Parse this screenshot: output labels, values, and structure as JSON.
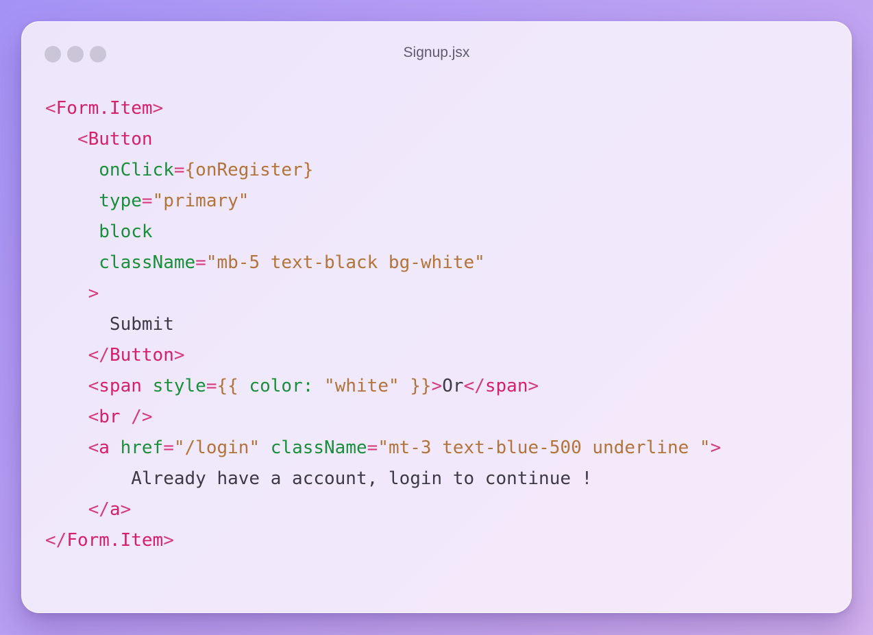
{
  "window": {
    "title": "Signup.jsx",
    "controls": [
      "window-dot",
      "window-dot",
      "window-dot"
    ]
  },
  "code": {
    "lines": [
      [
        {
          "t": "<",
          "c": "pun"
        },
        {
          "t": "Form.Item",
          "c": "tag"
        },
        {
          "t": ">",
          "c": "pun"
        }
      ],
      [
        {
          "t": "   ",
          "c": "txt"
        },
        {
          "t": "<",
          "c": "pun"
        },
        {
          "t": "Button",
          "c": "tag"
        }
      ],
      [
        {
          "t": "     ",
          "c": "txt"
        },
        {
          "t": "onClick",
          "c": "attr"
        },
        {
          "t": "=",
          "c": "pun"
        },
        {
          "t": "{onRegister}",
          "c": "str"
        }
      ],
      [
        {
          "t": "     ",
          "c": "txt"
        },
        {
          "t": "type",
          "c": "attr"
        },
        {
          "t": "=",
          "c": "pun"
        },
        {
          "t": "\"primary\"",
          "c": "str"
        }
      ],
      [
        {
          "t": "     ",
          "c": "txt"
        },
        {
          "t": "block",
          "c": "attr"
        }
      ],
      [
        {
          "t": "     ",
          "c": "txt"
        },
        {
          "t": "className",
          "c": "attr"
        },
        {
          "t": "=",
          "c": "pun"
        },
        {
          "t": "\"mb-5 text-black bg-white\"",
          "c": "str"
        }
      ],
      [
        {
          "t": "    ",
          "c": "txt"
        },
        {
          "t": ">",
          "c": "pun"
        }
      ],
      [
        {
          "t": "      ",
          "c": "txt"
        },
        {
          "t": "Submit",
          "c": "txt"
        }
      ],
      [
        {
          "t": "    ",
          "c": "txt"
        },
        {
          "t": "</",
          "c": "pun"
        },
        {
          "t": "Button",
          "c": "tag"
        },
        {
          "t": ">",
          "c": "pun"
        }
      ],
      [
        {
          "t": "    ",
          "c": "txt"
        },
        {
          "t": "<",
          "c": "pun"
        },
        {
          "t": "span",
          "c": "tag"
        },
        {
          "t": " ",
          "c": "txt"
        },
        {
          "t": "style",
          "c": "attr"
        },
        {
          "t": "=",
          "c": "pun"
        },
        {
          "t": "{{",
          "c": "str"
        },
        {
          "t": " ",
          "c": "txt"
        },
        {
          "t": "color:",
          "c": "attr"
        },
        {
          "t": " ",
          "c": "txt"
        },
        {
          "t": "\"white\"",
          "c": "str"
        },
        {
          "t": " ",
          "c": "txt"
        },
        {
          "t": "}}",
          "c": "str"
        },
        {
          "t": ">",
          "c": "pun"
        },
        {
          "t": "Or",
          "c": "txt"
        },
        {
          "t": "</",
          "c": "pun"
        },
        {
          "t": "span",
          "c": "tag"
        },
        {
          "t": ">",
          "c": "pun"
        }
      ],
      [
        {
          "t": "    ",
          "c": "txt"
        },
        {
          "t": "<",
          "c": "pun"
        },
        {
          "t": "br",
          "c": "tag"
        },
        {
          "t": " ",
          "c": "txt"
        },
        {
          "t": "/>",
          "c": "pun"
        }
      ],
      [
        {
          "t": "    ",
          "c": "txt"
        },
        {
          "t": "<",
          "c": "pun"
        },
        {
          "t": "a",
          "c": "tag"
        },
        {
          "t": " ",
          "c": "txt"
        },
        {
          "t": "href",
          "c": "attr"
        },
        {
          "t": "=",
          "c": "pun"
        },
        {
          "t": "\"/login\"",
          "c": "str"
        },
        {
          "t": " ",
          "c": "txt"
        },
        {
          "t": "className",
          "c": "attr"
        },
        {
          "t": "=",
          "c": "pun"
        },
        {
          "t": "\"mt-3 text-blue-500 underline \"",
          "c": "str"
        },
        {
          "t": ">",
          "c": "pun"
        }
      ],
      [
        {
          "t": "        ",
          "c": "txt"
        },
        {
          "t": "Already have a account, login to continue !",
          "c": "txt"
        }
      ],
      [
        {
          "t": "    ",
          "c": "txt"
        },
        {
          "t": "</",
          "c": "pun"
        },
        {
          "t": "a",
          "c": "tag"
        },
        {
          "t": ">",
          "c": "pun"
        }
      ],
      [
        {
          "t": "</",
          "c": "pun"
        },
        {
          "t": "Form.Item",
          "c": "tag"
        },
        {
          "t": ">",
          "c": "pun"
        }
      ]
    ]
  },
  "colors": {
    "tag": "#d81f6b",
    "punctuation": "#d63b7c",
    "attribute": "#1a8f3b",
    "string": "#b2743a",
    "text": "#3d3a46",
    "window_dot": "#cbc5d8"
  }
}
